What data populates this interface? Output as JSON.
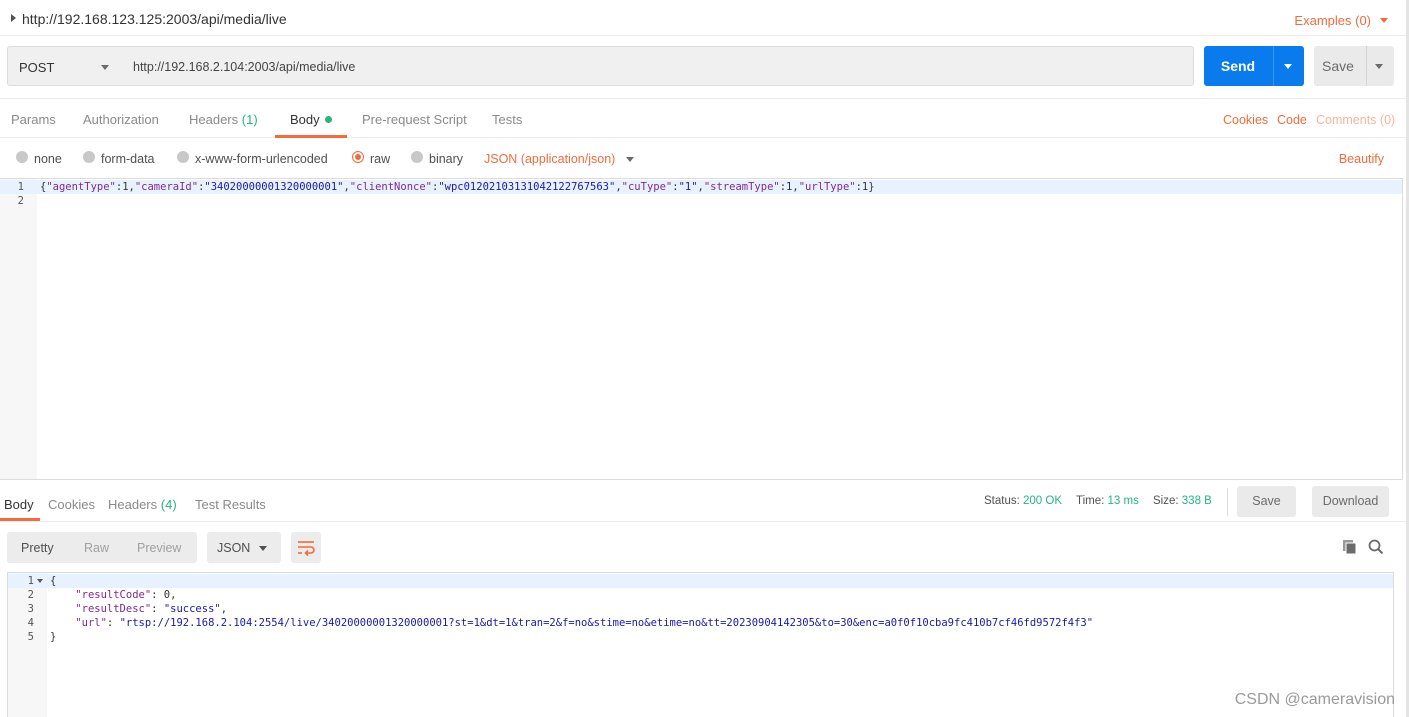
{
  "request": {
    "title": "http://192.168.123.125:2003/api/media/live",
    "examples_label": "Examples (0)",
    "method": "POST",
    "url": "http://192.168.2.104:2003/api/media/live",
    "send_label": "Send",
    "save_label": "Save"
  },
  "request_tabs": {
    "params": "Params",
    "authorization": "Authorization",
    "headers": "Headers",
    "headers_count": "(1)",
    "body": "Body",
    "prerequest": "Pre-request Script",
    "tests": "Tests",
    "active": "Body"
  },
  "request_links": {
    "cookies": "Cookies",
    "code": "Code",
    "comments": "Comments (0)"
  },
  "body_types": {
    "none": "none",
    "form_data": "form-data",
    "urlencoded": "x-www-form-urlencoded",
    "raw": "raw",
    "binary": "binary",
    "selected": "raw",
    "content_type": "JSON (application/json)",
    "beautify": "Beautify"
  },
  "request_body": {
    "line_numbers": [
      "1",
      "2"
    ],
    "line1": {
      "p1": "{",
      "k1": "\"agentType\"",
      "p2": ":1,",
      "k2": "\"cameraId\"",
      "p3": ":",
      "v2": "\"34020000001320000001\"",
      "p4": ",",
      "k3": "\"clientNonce\"",
      "p5": ":",
      "v3": "\"wpc0120210313104212276756З\"",
      "p6": ",",
      "k4": "\"cuType\"",
      "p7": ":",
      "v4": "\"1\"",
      "p8": ",",
      "k5": "\"streamType\"",
      "p9": ":1,",
      "k6": "\"urlType\"",
      "p10": ":1}"
    }
  },
  "response_tabs": {
    "body": "Body",
    "cookies": "Cookies",
    "headers": "Headers",
    "headers_count": "(4)",
    "test_results": "Test Results"
  },
  "response_meta": {
    "status_label": "Status:",
    "status_value": "200 OK",
    "time_label": "Time:",
    "time_value": "13 ms",
    "size_label": "Size:",
    "size_value": "338 B",
    "save_label": "Save",
    "download_label": "Download"
  },
  "response_view": {
    "pretty": "Pretty",
    "raw": "Raw",
    "preview": "Preview",
    "format": "JSON"
  },
  "response_body": {
    "line_numbers": [
      "1",
      "2",
      "3",
      "4",
      "5"
    ],
    "l1": "{",
    "l2_key": "\"resultCode\"",
    "l2_rest": ": 0,",
    "l3_key": "\"resultDesc\"",
    "l3_sep": ": ",
    "l3_val": "\"success\"",
    "l3_end": ",",
    "l4_key": "\"url\"",
    "l4_sep": ": ",
    "l4_val": "\"rtsp://192.168.2.104:2554/live/34020000001320000001?st=1&dt=1&tran=2&f=no&stime=no&etime=no&tt=20230904142305&to=30&enc=a0f0f10cba9fc410b7cf46fd9572f4f3\"",
    "l5": "}"
  },
  "watermark": "CSDN @cameravision",
  "colors": {
    "accent": "#f26b3a",
    "send": "#097bed",
    "success": "#26b47f",
    "json_key": "#7d2a91",
    "json_string": "#1a1aa6"
  }
}
